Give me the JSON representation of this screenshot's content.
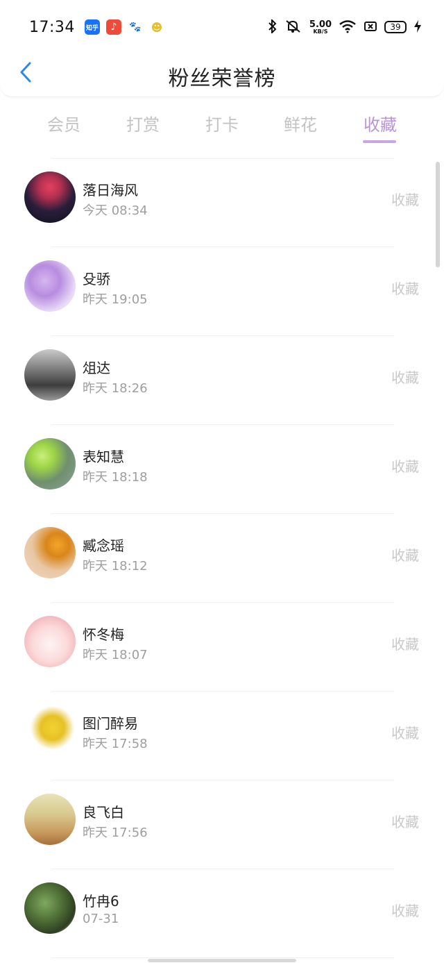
{
  "status_bar": {
    "time": "17:34",
    "apps": [
      {
        "icon": "zhihu-icon",
        "label": "知乎",
        "color": "#1772F6"
      },
      {
        "icon": "music-icon",
        "label": "♪",
        "color": "#EE4B3A"
      },
      {
        "icon": "baidu-icon",
        "label": "🐾",
        "color": "#2B5CE6"
      },
      {
        "icon": "duck-icon",
        "label": "☻",
        "color": "#E3C12D"
      }
    ],
    "speed_value": "5.00",
    "speed_unit": "KB/S",
    "battery": "39"
  },
  "header": {
    "title": "粉丝荣誉榜"
  },
  "tabs": [
    {
      "label": "会员"
    },
    {
      "label": "打赏"
    },
    {
      "label": "打卡"
    },
    {
      "label": "鲜花"
    },
    {
      "label": "收藏"
    }
  ],
  "active_tab": "收藏",
  "accent_color": "#b895d6",
  "fans": [
    {
      "name": "落日海风",
      "time": "今天 08:34",
      "action": "收藏"
    },
    {
      "name": "殳骄",
      "time": "昨天 19:05",
      "action": "收藏"
    },
    {
      "name": "俎达",
      "time": "昨天 18:26",
      "action": "收藏"
    },
    {
      "name": "表知慧",
      "time": "昨天 18:18",
      "action": "收藏"
    },
    {
      "name": "臧念瑶",
      "time": "昨天 18:12",
      "action": "收藏"
    },
    {
      "name": "怀冬梅",
      "time": "昨天 18:07",
      "action": "收藏"
    },
    {
      "name": "图门醉易",
      "time": "昨天 17:58",
      "action": "收藏"
    },
    {
      "name": "良飞白",
      "time": "昨天 17:56",
      "action": "收藏"
    },
    {
      "name": "竹冉6",
      "time": "07-31",
      "action": "收藏"
    }
  ]
}
